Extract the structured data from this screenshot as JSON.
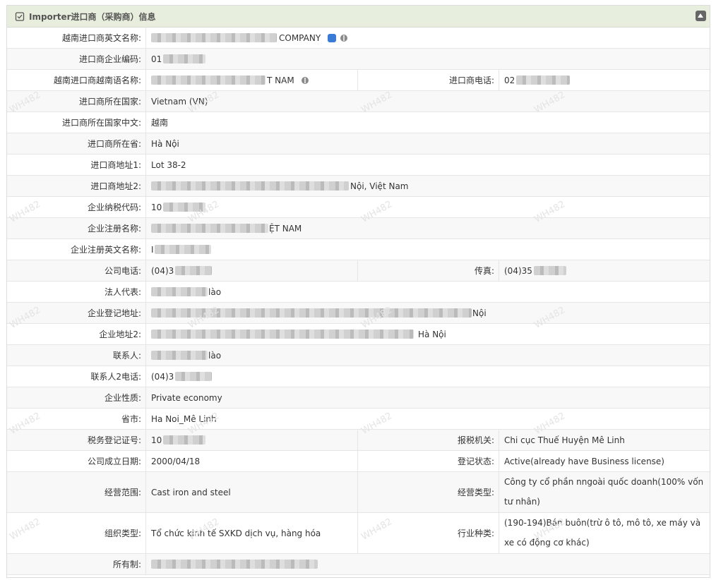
{
  "panel": {
    "title": "Importer进口商（采购商）信息"
  },
  "rows": [
    {
      "label": "越南进口商英文名称:",
      "value": "COMPANY"
    },
    {
      "label": "进口商企业编码:",
      "value": "01"
    },
    {
      "label": "越南进口商越南语名称:",
      "value": "T NAM",
      "label2": "进口商电话:",
      "value2": "02"
    },
    {
      "label": "进口商所在国家:",
      "value": "Vietnam (VN)"
    },
    {
      "label": "进口商所在国家中文:",
      "value": "越南"
    },
    {
      "label": "进口商所在省:",
      "value": "Hà Nội"
    },
    {
      "label": "进口商地址1:",
      "value": "Lot 38-2"
    },
    {
      "label": "进口商地址2:",
      "value": "Nội, Việt Nam"
    },
    {
      "label": "企业纳税代码:",
      "value": "10"
    },
    {
      "label": "企业注册名称:",
      "value": "ỆT NAM"
    },
    {
      "label": "企业注册英文名称:",
      "value": "I"
    },
    {
      "label": "公司电话:",
      "value": "(04)3",
      "label2": "传真:",
      "value2": "(04)35"
    },
    {
      "label": "法人代表:",
      "value": "lào"
    },
    {
      "label": "企业登记地址:",
      "value": "Nội"
    },
    {
      "label": "企业地址2:",
      "value": "Hà Nội"
    },
    {
      "label": "联系人:",
      "value": "lào"
    },
    {
      "label": "联系人2电话:",
      "value": "(04)3"
    },
    {
      "label": "企业性质:",
      "value": "Private economy"
    },
    {
      "label": "省市:",
      "value": "Ha Noi_Mê Linh"
    },
    {
      "label": "税务登记证号:",
      "value": "10",
      "label2": "报税机关:",
      "value2": "Chi cục Thuế Huyện Mê Linh"
    },
    {
      "label": "公司成立日期:",
      "value": "2000/04/18",
      "label2": "登记状态:",
      "value2": "Active(already have Business license)"
    },
    {
      "label": "经营范围:",
      "value": "Cast iron and steel",
      "label2": "经营类型:",
      "value2": "Công ty cổ phần nngoài quốc doanh(100% vốn tư nhân)"
    },
    {
      "label": "组织类型:",
      "value": "Tổ chức kinh tế SXKD dịch vụ, hàng hóa",
      "label2": "行业种类:",
      "value2": "(190-194)Bán buôn(trừ ô tô, mô tô, xe máy và xe có động cơ khác)"
    },
    {
      "label": "所有制:",
      "value": ""
    }
  ],
  "watermark": "WH482"
}
